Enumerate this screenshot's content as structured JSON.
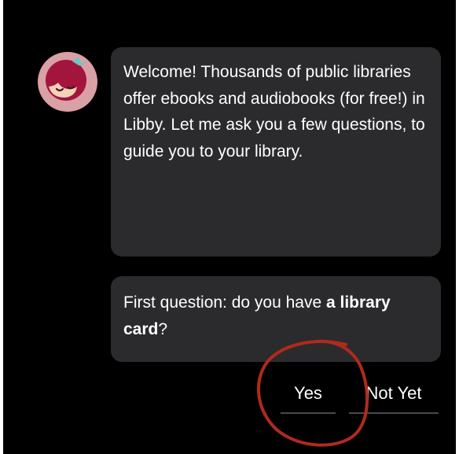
{
  "chat": {
    "avatar_icon": "libby-avatar-icon",
    "message1": "Welcome! Thousands of public libraries offer ebooks and audiobooks (for free!) in Libby. Let me ask you a few questions, to guide you to your library.",
    "message2_prefix": "First question: do you have ",
    "message2_bold": "a library card",
    "message2_suffix": "?"
  },
  "replies": {
    "yes_label": "Yes",
    "not_yet_label": "Not Yet"
  },
  "colors": {
    "background": "#000000",
    "bubble": "#2b2b2d",
    "text": "#ffffff",
    "annotation": "#b02a1c"
  }
}
